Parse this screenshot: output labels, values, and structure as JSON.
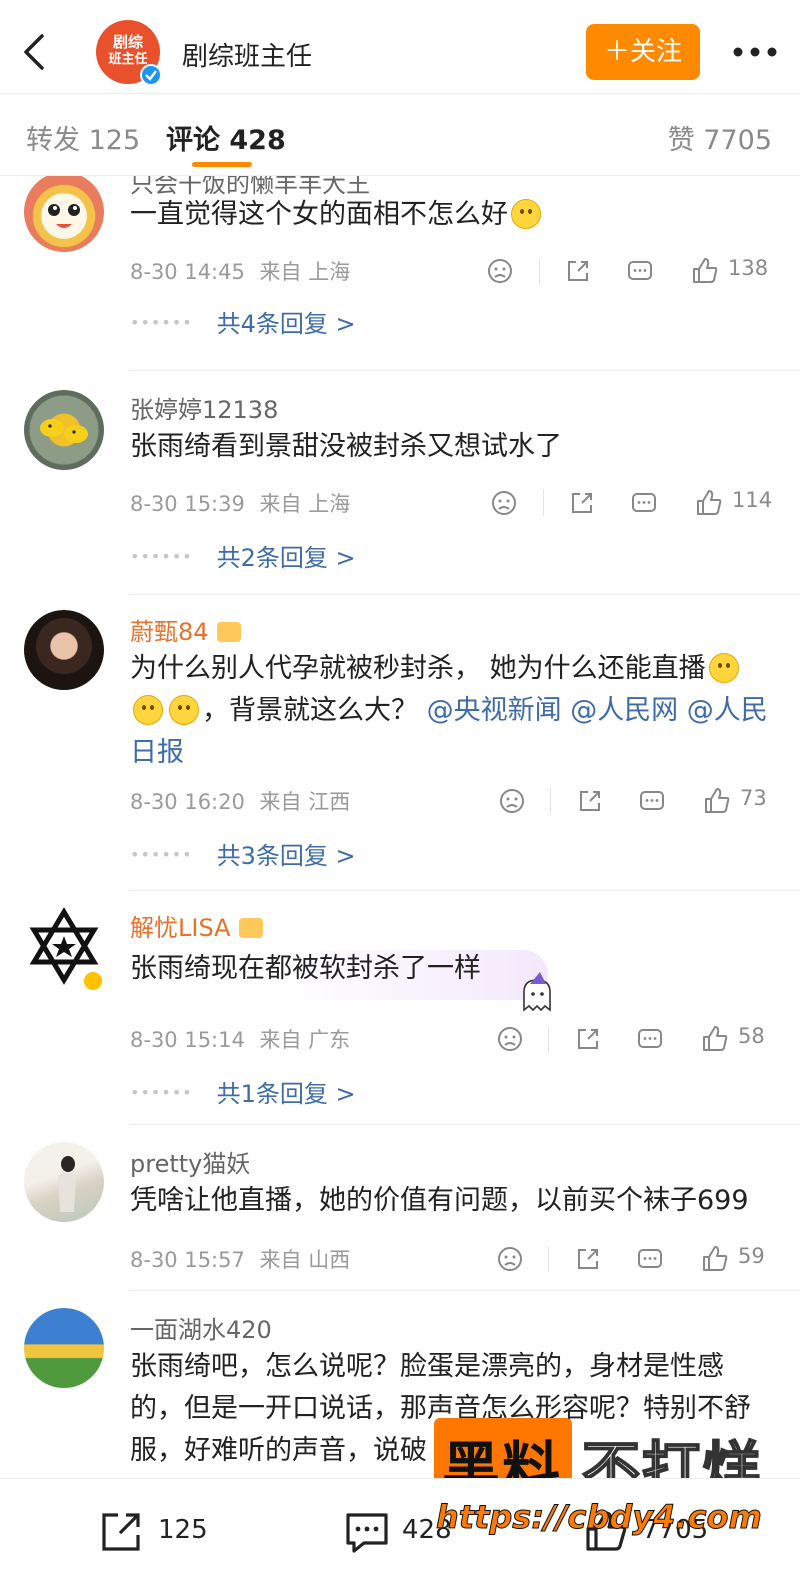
{
  "header": {
    "account_name": "剧综班主任",
    "avatar_text_line1": "剧综",
    "avatar_text_line2": "班主任",
    "follow_label": "＋关注"
  },
  "tabs": {
    "repost": "转发 125",
    "comment": "评论 428",
    "likes": "赞 7705"
  },
  "comments": [
    {
      "username": "只会干饭的懒羊羊大王",
      "text": "一直觉得这个女的面相不怎么好",
      "time": "8-30 14:45",
      "location": "来自 上海",
      "likes": "138",
      "replies": "共4条回复 >"
    },
    {
      "username": "张婷婷12138",
      "text": "张雨绮看到景甜没被封杀又想试水了",
      "time": "8-30 15:39",
      "location": "来自 上海",
      "likes": "114",
      "replies": "共2条回复 >"
    },
    {
      "username": "蔚甄84",
      "text_part1": "为什么别人代孕就被秒封杀， 她为什么还能直播",
      "text_part2": "，背景就这么大？",
      "mention1": "@央视新闻",
      "mention2": "@人民网",
      "mention3": "@人民日报",
      "time": "8-30 16:20",
      "location": "来自 江西",
      "likes": "73",
      "replies": "共3条回复 >"
    },
    {
      "username": "解忧LISA",
      "text": "张雨绮现在都被软封杀了一样",
      "time": "8-30 15:14",
      "location": "来自 广东",
      "likes": "58",
      "replies": "共1条回复 >"
    },
    {
      "username": "pretty猫妖",
      "text": "凭啥让他直播，她的价值有问题，以前买个袜子699",
      "time": "8-30 15:57",
      "location": "来自 山西",
      "likes": "59"
    },
    {
      "username": "一面湖水420",
      "text": "张雨绮吧，怎么说呢？脸蛋是漂亮的，身材是性感的，但是一开口说话，那声音怎么形容呢？特别不舒服，好难听的声音，说破"
    }
  ],
  "bottom_bar": {
    "repost_count": "125",
    "comment_count": "428",
    "like_count": "7705"
  },
  "watermark": {
    "black_text": "黑料",
    "white_text": "不打烊",
    "url": "https://cbdy4.com"
  },
  "colors": {
    "accent": "#ff8a00",
    "mention": "#3f6ca8",
    "vip_name": "#e8712c"
  }
}
